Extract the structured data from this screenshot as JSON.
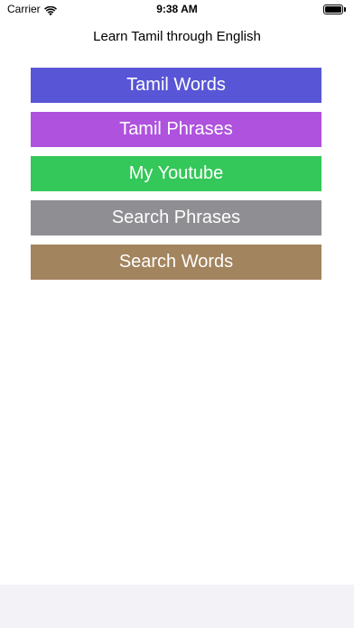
{
  "status_bar": {
    "carrier": "Carrier",
    "time": "9:38 AM",
    "icons": [
      "wifi-icon",
      "battery-icon"
    ]
  },
  "header": {
    "title": "Learn Tamil through English"
  },
  "menu": {
    "buttons": [
      {
        "label": "Tamil Words",
        "color": "#5856d6"
      },
      {
        "label": "Tamil Phrases",
        "color": "#af52de"
      },
      {
        "label": "My Youtube",
        "color": "#34c759"
      },
      {
        "label": "Search Phrases",
        "color": "#8e8e93"
      },
      {
        "label": "Search Words",
        "color": "#a2845e"
      }
    ]
  },
  "colors": {
    "background": "#ffffff",
    "bottom_bar": "#f2f2f7"
  }
}
